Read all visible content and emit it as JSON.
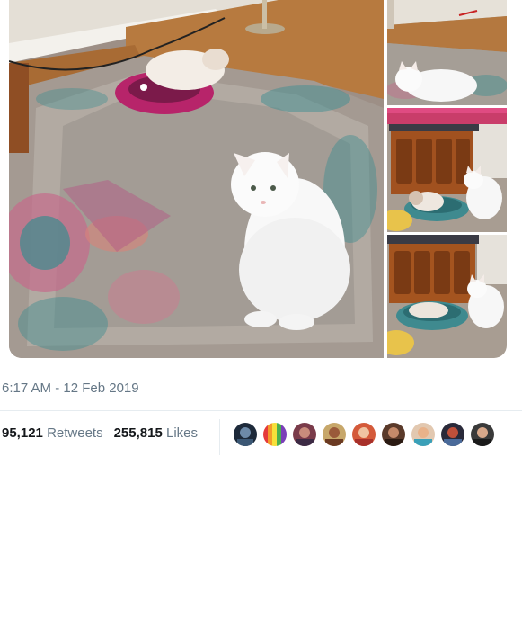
{
  "tweet": {
    "timestamp": "6:17 AM - 12 Feb 2019",
    "retweets_count": "95,121",
    "retweets_label": "Retweets",
    "likes_count": "255,815",
    "likes_label": "Likes"
  },
  "media": {
    "photo_count": 4
  },
  "liked_by_avatar_count": 9,
  "colors": {
    "meta_text": "#657786",
    "count_text": "#14171a",
    "divider": "#e6ecf0"
  }
}
